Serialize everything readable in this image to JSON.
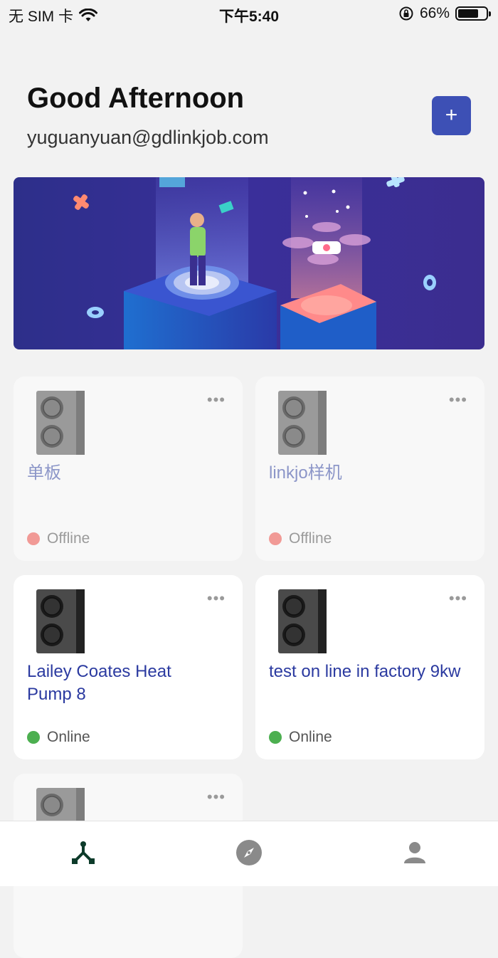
{
  "status_bar": {
    "carrier": "无 SIM 卡",
    "time": "下午5:40",
    "battery": "66%"
  },
  "header": {
    "greeting": "Good Afternoon",
    "email": "yuguanyuan@gdlinkjob.com",
    "add_label": "+"
  },
  "devices": [
    {
      "name": "单板",
      "status": "Offline"
    },
    {
      "name": "linkjo样机",
      "status": "Offline"
    },
    {
      "name": "Lailey Coates Heat Pump 8",
      "status": "Online"
    },
    {
      "name": "test on line in factory 9kw",
      "status": "Online"
    },
    {
      "name": "",
      "status": ""
    }
  ],
  "more_label": "•••",
  "colors": {
    "accent": "#3d50b5",
    "online": "#4caf50",
    "offline": "#f19a96",
    "tab_active": "#0d3b2a",
    "tab_inactive": "#8a8a8a"
  },
  "tabs": [
    {
      "icon": "devices-icon",
      "active": true
    },
    {
      "icon": "compass-icon",
      "active": false
    },
    {
      "icon": "person-icon",
      "active": false
    }
  ]
}
